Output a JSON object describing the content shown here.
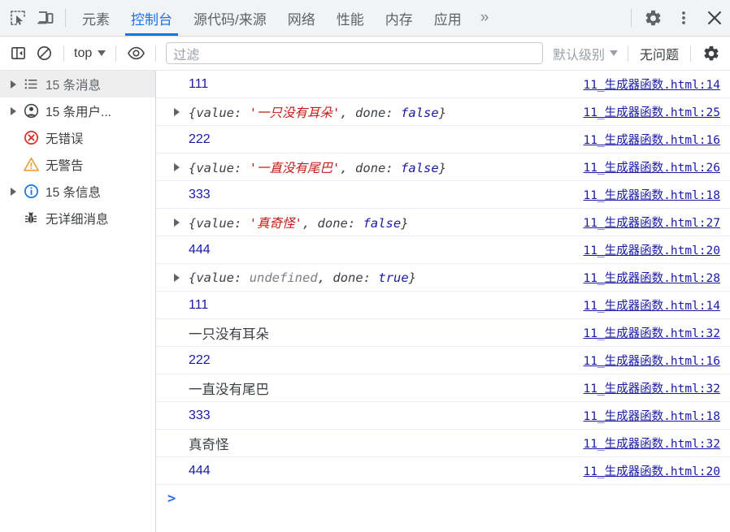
{
  "tabbar": {
    "inspect_icon": "inspect-cursor-icon",
    "device_icon": "device-toolbar-icon",
    "tabs": [
      {
        "label": "元素",
        "active": false
      },
      {
        "label": "控制台",
        "active": true
      },
      {
        "label": "源代码/来源",
        "active": false
      },
      {
        "label": "网络",
        "active": false
      },
      {
        "label": "性能",
        "active": false
      },
      {
        "label": "内存",
        "active": false
      },
      {
        "label": "应用",
        "active": false
      }
    ],
    "more_label": "»",
    "settings_icon": "gear-icon",
    "menu_icon": "kebab-menu-icon",
    "close_icon": "close-icon"
  },
  "filterbar": {
    "sidebar_toggle_icon": "sidebar-panel-icon",
    "clear_icon": "clear-console-icon",
    "context_label": "top",
    "eye_icon": "live-expression-eye-icon",
    "filter_placeholder": "过滤",
    "filter_value": "",
    "level_label": "默认级别",
    "issues_label": "无问题",
    "gear_icon": "console-settings-gear-icon"
  },
  "sidebar": {
    "items": [
      {
        "label": "15 条消息",
        "icon": "list-icon",
        "expandable": true,
        "selected": true
      },
      {
        "label": "15 条用户...",
        "icon": "user-message-icon",
        "expandable": true,
        "selected": false
      },
      {
        "label": "无错误",
        "icon": "error-icon",
        "expandable": false,
        "selected": false
      },
      {
        "label": "无警告",
        "icon": "warning-icon",
        "expandable": false,
        "selected": false
      },
      {
        "label": "15 条信息",
        "icon": "info-icon",
        "expandable": true,
        "selected": false
      },
      {
        "label": "无详细消息",
        "icon": "verbose-bug-icon",
        "expandable": false,
        "selected": false
      }
    ]
  },
  "console": {
    "prompt_chevron": ">",
    "messages": [
      {
        "kind": "number",
        "text": "111",
        "expandable": false,
        "source": "11_生成器函数.html:14"
      },
      {
        "kind": "object",
        "expandable": true,
        "source": "11_生成器函数.html:25",
        "parts": [
          {
            "t": "{",
            "c": "punct"
          },
          {
            "t": "value",
            "c": "key"
          },
          {
            "t": ": ",
            "c": "punct"
          },
          {
            "t": "'一只没有耳朵'",
            "c": "str"
          },
          {
            "t": ", ",
            "c": "punct"
          },
          {
            "t": "done",
            "c": "key"
          },
          {
            "t": ": ",
            "c": "punct"
          },
          {
            "t": "false",
            "c": "bool"
          },
          {
            "t": "}",
            "c": "punct"
          }
        ]
      },
      {
        "kind": "number",
        "text": "222",
        "expandable": false,
        "source": "11_生成器函数.html:16"
      },
      {
        "kind": "object",
        "expandable": true,
        "source": "11_生成器函数.html:26",
        "parts": [
          {
            "t": "{",
            "c": "punct"
          },
          {
            "t": "value",
            "c": "key"
          },
          {
            "t": ": ",
            "c": "punct"
          },
          {
            "t": "'一直没有尾巴'",
            "c": "str"
          },
          {
            "t": ", ",
            "c": "punct"
          },
          {
            "t": "done",
            "c": "key"
          },
          {
            "t": ": ",
            "c": "punct"
          },
          {
            "t": "false",
            "c": "bool"
          },
          {
            "t": "}",
            "c": "punct"
          }
        ]
      },
      {
        "kind": "number",
        "text": "333",
        "expandable": false,
        "source": "11_生成器函数.html:18"
      },
      {
        "kind": "object",
        "expandable": true,
        "source": "11_生成器函数.html:27",
        "parts": [
          {
            "t": "{",
            "c": "punct"
          },
          {
            "t": "value",
            "c": "key"
          },
          {
            "t": ": ",
            "c": "punct"
          },
          {
            "t": "'真奇怪'",
            "c": "str"
          },
          {
            "t": ", ",
            "c": "punct"
          },
          {
            "t": "done",
            "c": "key"
          },
          {
            "t": ": ",
            "c": "punct"
          },
          {
            "t": "false",
            "c": "bool"
          },
          {
            "t": "}",
            "c": "punct"
          }
        ]
      },
      {
        "kind": "number",
        "text": "444",
        "expandable": false,
        "source": "11_生成器函数.html:20"
      },
      {
        "kind": "object",
        "expandable": true,
        "source": "11_生成器函数.html:28",
        "parts": [
          {
            "t": "{",
            "c": "punct"
          },
          {
            "t": "value",
            "c": "key"
          },
          {
            "t": ": ",
            "c": "punct"
          },
          {
            "t": "undefined",
            "c": "undef"
          },
          {
            "t": ", ",
            "c": "punct"
          },
          {
            "t": "done",
            "c": "key"
          },
          {
            "t": ": ",
            "c": "punct"
          },
          {
            "t": "true",
            "c": "bool"
          },
          {
            "t": "}",
            "c": "punct"
          }
        ]
      },
      {
        "kind": "number",
        "text": "111",
        "expandable": false,
        "source": "11_生成器函数.html:14"
      },
      {
        "kind": "text",
        "text": "一只没有耳朵",
        "expandable": false,
        "source": "11_生成器函数.html:32"
      },
      {
        "kind": "number",
        "text": "222",
        "expandable": false,
        "source": "11_生成器函数.html:16"
      },
      {
        "kind": "text",
        "text": "一直没有尾巴",
        "expandable": false,
        "source": "11_生成器函数.html:32"
      },
      {
        "kind": "number",
        "text": "333",
        "expandable": false,
        "source": "11_生成器函数.html:18"
      },
      {
        "kind": "text",
        "text": "真奇怪",
        "expandable": false,
        "source": "11_生成器函数.html:32"
      },
      {
        "kind": "number",
        "text": "444",
        "expandable": false,
        "source": "11_生成器函数.html:20"
      }
    ]
  },
  "colors": {
    "accent": "#1a73e8",
    "number": "#1a1aa6",
    "string": "#c41a16",
    "undefined": "#7f7f7f",
    "error": "#d93025",
    "warning": "#e8a33d",
    "info": "#1a73e8",
    "link": "#1a1aa6"
  }
}
